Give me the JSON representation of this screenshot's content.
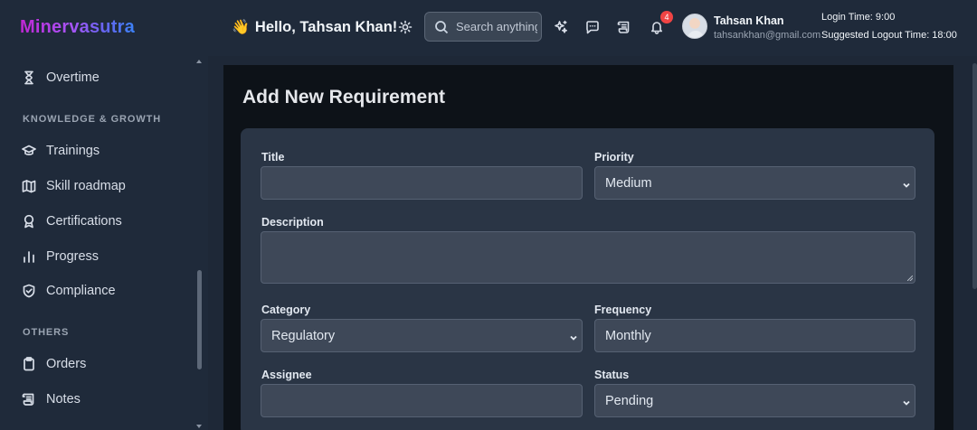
{
  "app": {
    "logo": "Minervasutra"
  },
  "sidebar": {
    "items_top": [
      {
        "label": "Overtime",
        "icon": "hourglass-icon"
      }
    ],
    "sections": [
      {
        "title": "KNOWLEDGE & GROWTH",
        "items": [
          {
            "label": "Trainings",
            "icon": "graduation-cap-icon"
          },
          {
            "label": "Skill roadmap",
            "icon": "map-icon"
          },
          {
            "label": "Certifications",
            "icon": "award-icon"
          },
          {
            "label": "Progress",
            "icon": "bar-chart-icon"
          },
          {
            "label": "Compliance",
            "icon": "shield-check-icon"
          }
        ]
      },
      {
        "title": "OTHERS",
        "items": [
          {
            "label": "Orders",
            "icon": "clipboard-icon"
          },
          {
            "label": "Notes",
            "icon": "scroll-icon"
          }
        ]
      }
    ]
  },
  "header": {
    "greeting_emoji": "👋",
    "greeting": "Hello, Tahsan Khan!",
    "search_placeholder": "Search anything",
    "notification_count": "4",
    "user": {
      "name": "Tahsan Khan",
      "email": "tahsankhan@gmail.com"
    },
    "login_time": "Login Time: 9:00",
    "logout_time": "Suggested Logout Time: 18:00"
  },
  "form": {
    "title": "Add New Requirement",
    "fields": {
      "title": {
        "label": "Title",
        "value": ""
      },
      "priority": {
        "label": "Priority",
        "value": "Medium"
      },
      "description": {
        "label": "Description",
        "value": ""
      },
      "category": {
        "label": "Category",
        "value": "Regulatory"
      },
      "frequency": {
        "label": "Frequency",
        "value": "Monthly"
      },
      "assignee": {
        "label": "Assignee",
        "value": ""
      },
      "status": {
        "label": "Status",
        "value": "Pending"
      }
    }
  },
  "colors": {
    "background": "#1e2837",
    "panel": "#0d1218",
    "card": "#2a3545",
    "input": "#3e4858",
    "badge": "#ef4444",
    "logo_gradient_start": "#c026d3",
    "logo_gradient_end": "#3b82f6"
  }
}
